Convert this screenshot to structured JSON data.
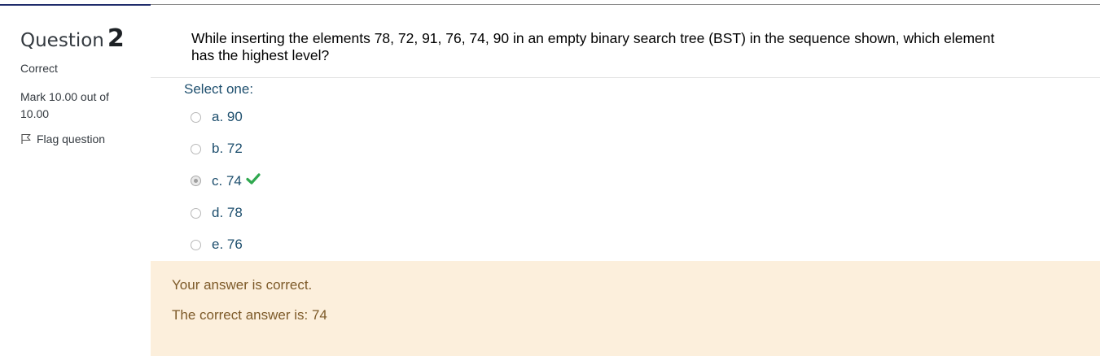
{
  "question_info": {
    "label": "Question",
    "number": "2",
    "state": "Correct",
    "grade": "Mark 10.00 out of 10.00",
    "flag_label": "Flag question"
  },
  "question": {
    "text": "While inserting the elements 78, 72, 91, 76, 74, 90 in an empty binary search tree (BST) in the sequence shown, which element has the highest level?",
    "prompt": "Select one:",
    "options": [
      {
        "label": "a. 90",
        "selected": false
      },
      {
        "label": "b. 72",
        "selected": false
      },
      {
        "label": "c. 74",
        "selected": true,
        "correct": true
      },
      {
        "label": "d. 78",
        "selected": false
      },
      {
        "label": "e. 76",
        "selected": false
      }
    ]
  },
  "feedback": {
    "result": "Your answer is correct.",
    "right_answer": "The correct answer is: 74"
  },
  "colors": {
    "link_text": "#1e4f6e",
    "feedback_bg": "#fcefdc",
    "feedback_text": "#7d5a29",
    "correct_tick": "#2fa84f"
  },
  "icons": {
    "flag": "flag-icon",
    "correct": "check-icon"
  }
}
